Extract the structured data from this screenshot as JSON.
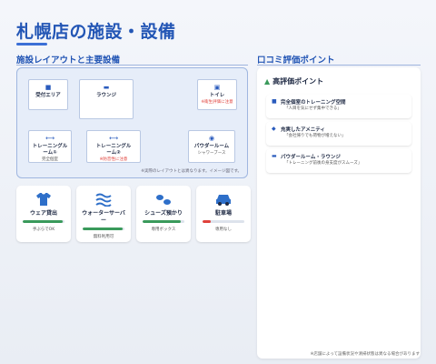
{
  "page_title": "札幌店の施設・設備",
  "sections": {
    "layout_title": "施設レイアウトと主要設備",
    "reviews_title": "口コミ評価ポイント"
  },
  "layout": {
    "rooms": [
      {
        "name": "受付エリア",
        "icon": "person-icon",
        "sub": ""
      },
      {
        "name": "ラウンジ",
        "icon": "sofa-icon",
        "sub": ""
      },
      {
        "name": "トイレ",
        "icon": "toilet-icon",
        "sub": "※衛生評価に注意"
      },
      {
        "name": "トレーニングルーム①",
        "icon": "dumbbell-icon",
        "sub": "完全個室"
      },
      {
        "name": "トレーニングルーム②",
        "icon": "dumbbell-icon",
        "sub": "※防音性に注意"
      },
      {
        "name": "パウダールーム",
        "icon": "mirror-icon",
        "sub": "シャワーブース"
      }
    ],
    "note": "※実際のレイアウトとは異なります。イメージ図です。"
  },
  "cards": [
    {
      "label": "ウェア貸出",
      "caption": "手ぶらでOK",
      "level": 0.95,
      "icon": "shirt-icon",
      "bar_color": "#3a9a5b"
    },
    {
      "label": "ウォーターサーバー",
      "caption": "無料利用可",
      "level": 0.95,
      "icon": "water-icon",
      "bar_color": "#3a9a5b"
    },
    {
      "label": "シューズ預かり",
      "caption": "専用ボックス",
      "level": 0.92,
      "icon": "shoes-icon",
      "bar_color": "#3a9a5b"
    },
    {
      "label": "駐車場",
      "caption": "専用なし",
      "level": 0.2,
      "icon": "car-icon",
      "bar_color": "#e0413b"
    }
  ],
  "reviews": {
    "heading": "高評価ポイント",
    "items": [
      {
        "title": "完全個室のトレーニング空間",
        "quote": "「人目を気にせず集中できる」",
        "icon": "person-icon"
      },
      {
        "title": "充実したアメニティ",
        "quote": "「会社帰りでも荷物が増えない」",
        "icon": "bottle-icon"
      },
      {
        "title": "パウダールーム・ラウンジ",
        "quote": "「トレーニング前後の身支度がスムーズ」",
        "icon": "sofa-icon"
      }
    ]
  },
  "footnote": "※店舗によって設備状況や清掃状態は異なる場合があります",
  "colors": {
    "accent": "#2356b5",
    "good": "#3a9a5b",
    "warn": "#e0413b"
  }
}
